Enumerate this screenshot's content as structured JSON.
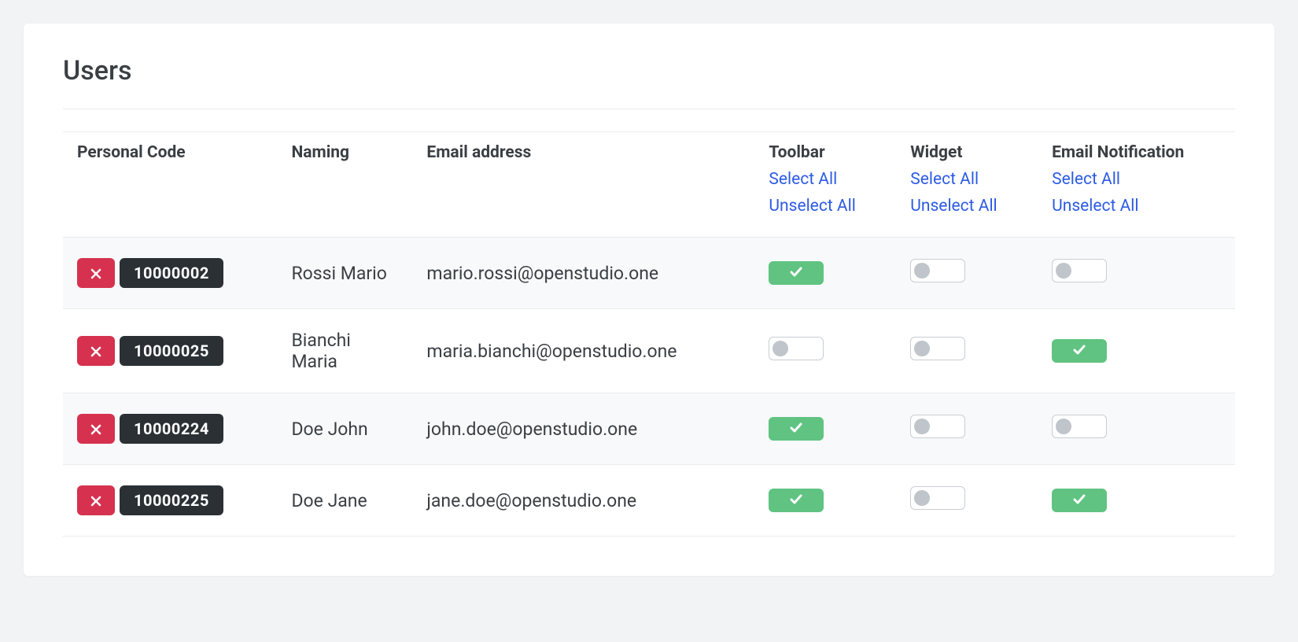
{
  "page": {
    "title": "Users"
  },
  "columns": {
    "personal_code": "Personal Code",
    "naming": "Naming",
    "email": "Email address",
    "toolbar": "Toolbar",
    "widget": "Widget",
    "email_notification": "Email Notification"
  },
  "actions": {
    "select_all": "Select All",
    "unselect_all": "Unselect All"
  },
  "rows": [
    {
      "code": "10000002",
      "naming": "Rossi Mario",
      "email": "mario.rossi@openstudio.one",
      "toolbar": true,
      "widget": false,
      "email_notification": false
    },
    {
      "code": "10000025",
      "naming": "Bianchi Maria",
      "email": "maria.bianchi@openstudio.one",
      "toolbar": false,
      "widget": false,
      "email_notification": true
    },
    {
      "code": "10000224",
      "naming": "Doe John",
      "email": "john.doe@openstudio.one",
      "toolbar": true,
      "widget": false,
      "email_notification": false
    },
    {
      "code": "10000225",
      "naming": "Doe Jane",
      "email": "jane.doe@openstudio.one",
      "toolbar": true,
      "widget": false,
      "email_notification": true
    }
  ]
}
